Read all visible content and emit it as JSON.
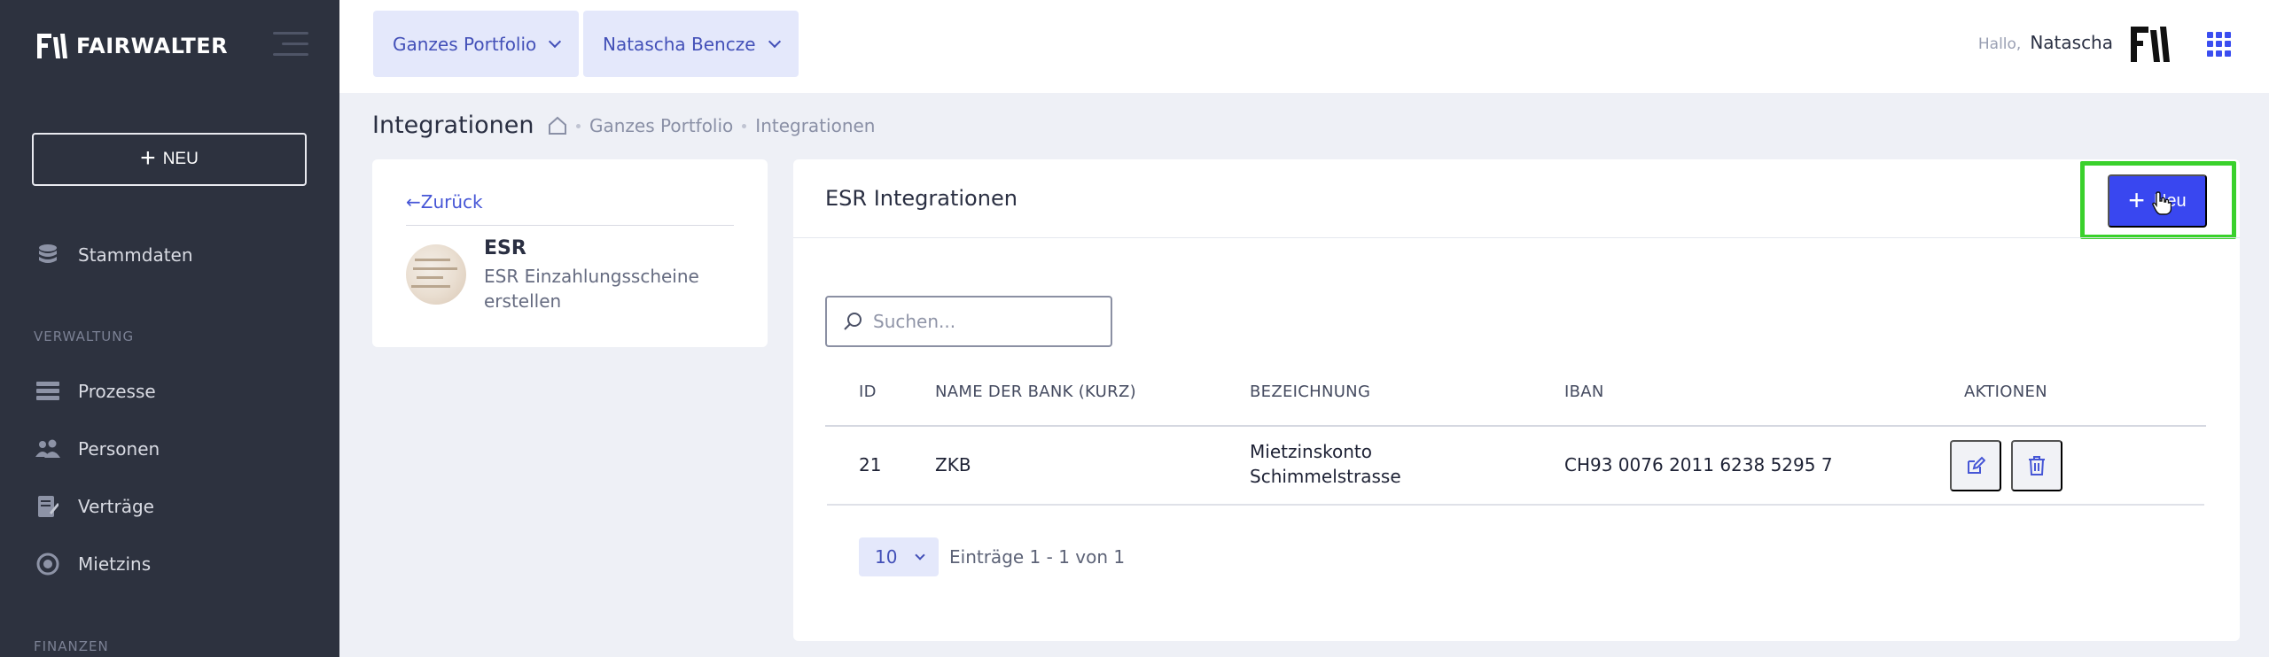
{
  "sidebar": {
    "brand": "FAIRWALTER",
    "new_button": "NEU",
    "items": [
      {
        "label": "Stammdaten",
        "icon": "database-icon"
      },
      {
        "label": "Prozesse",
        "icon": "processes-icon"
      },
      {
        "label": "Personen",
        "icon": "people-icon"
      },
      {
        "label": "Verträge",
        "icon": "contract-icon"
      },
      {
        "label": "Mietzins",
        "icon": "rent-icon"
      }
    ],
    "sections": {
      "verwaltung": "VERWALTUNG",
      "finanzen": "FINANZEN"
    }
  },
  "topbar": {
    "portfolio": "Ganzes Portfolio",
    "user_select": "Natascha Bencze",
    "hello": "Hallo,",
    "user_name": "Natascha"
  },
  "page": {
    "title": "Integrationen",
    "breadcrumb": [
      "Ganzes Portfolio",
      "Integrationen"
    ]
  },
  "left_card": {
    "back": "Zurück",
    "title": "ESR",
    "description": "ESR Einzahlungsscheine erstellen"
  },
  "main": {
    "title": "ESR Integrationen",
    "new_button": "Neu",
    "search_placeholder": "Suchen...",
    "columns": [
      "ID",
      "NAME DER BANK (KURZ)",
      "BEZEICHNUNG",
      "IBAN",
      "AKTIONEN"
    ],
    "rows": [
      {
        "id": "21",
        "bank": "ZKB",
        "bezeichnung_1": "Mietzinskonto",
        "bezeichnung_2": "Schimmelstrasse",
        "iban": "CH93 0076 2011 6238 5295 7"
      }
    ],
    "page_size": "10",
    "entries_text": "Einträge 1 - 1 von 1"
  },
  "colors": {
    "sidebar": "#2d323f",
    "accent": "#3947f0",
    "highlight": "#3ad12c",
    "chip_bg": "#e4e8fb"
  }
}
